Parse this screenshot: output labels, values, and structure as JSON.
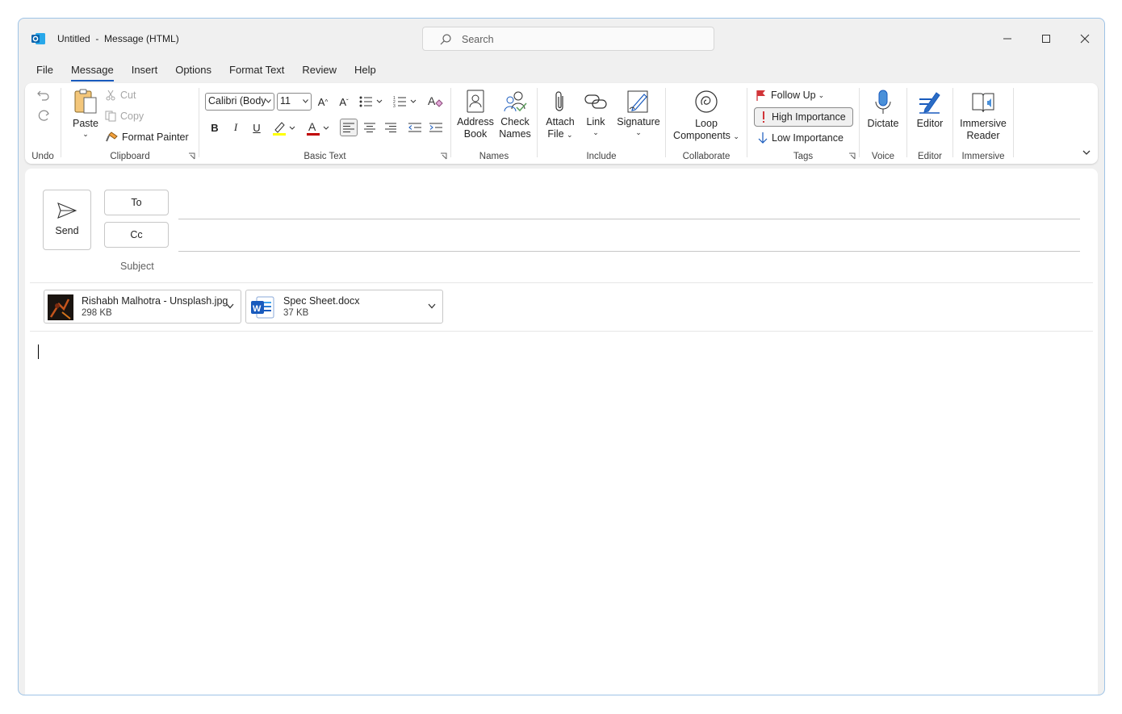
{
  "title": {
    "doc": "Untitled",
    "sep": "-",
    "kind": "Message (HTML)"
  },
  "search": {
    "placeholder": "Search"
  },
  "tabs": [
    "File",
    "Message",
    "Insert",
    "Options",
    "Format Text",
    "Review",
    "Help"
  ],
  "ribbon": {
    "undo": {
      "label": "Undo"
    },
    "clipboard": {
      "label": "Clipboard",
      "paste": "Paste",
      "cut": "Cut",
      "copy": "Copy",
      "format_painter": "Format Painter"
    },
    "basic_text": {
      "label": "Basic Text",
      "font": "Calibri (Body",
      "size": "11",
      "bold": "B",
      "italic": "I",
      "underline": "U"
    },
    "names": {
      "label": "Names",
      "address_book_1": "Address",
      "address_book_2": "Book",
      "check_names_1": "Check",
      "check_names_2": "Names"
    },
    "include": {
      "label": "Include",
      "attach_1": "Attach",
      "attach_2": "File",
      "link": "Link",
      "signature": "Signature"
    },
    "collaborate": {
      "label": "Collaborate",
      "loop_1": "Loop",
      "loop_2": "Components"
    },
    "tags": {
      "label": "Tags",
      "follow_up": "Follow Up",
      "high_importance": "High Importance",
      "low_importance": "Low Importance"
    },
    "voice": {
      "label": "Voice",
      "dictate": "Dictate"
    },
    "editor": {
      "label": "Editor",
      "editor": "Editor"
    },
    "immersive": {
      "label": "Immersive",
      "reader_1": "Immersive",
      "reader_2": "Reader"
    }
  },
  "compose": {
    "send": "Send",
    "to": "To",
    "cc": "Cc",
    "subject": "Subject",
    "attachments": [
      {
        "name": "Rishabh Malhotra - Unsplash.jpg",
        "size": "298 KB"
      },
      {
        "name": "Spec Sheet.docx",
        "size": "37 KB"
      }
    ]
  },
  "colors": {
    "accent": "#185abd",
    "highlight": "#ffff00",
    "font_color": "#c00000",
    "flag": "#d13438"
  }
}
